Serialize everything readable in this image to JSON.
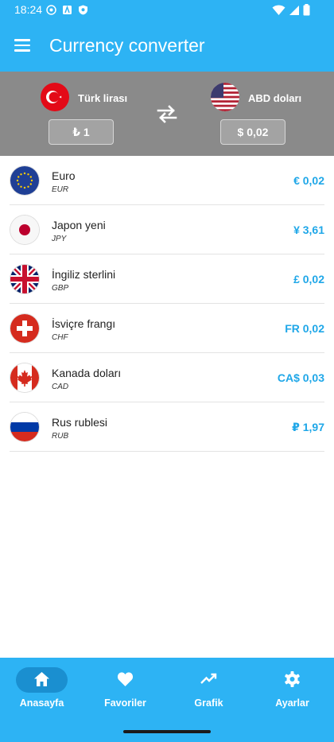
{
  "status_bar": {
    "time": "18:24"
  },
  "app_bar": {
    "title": "Currency converter"
  },
  "converter": {
    "from": {
      "name": "Türk lirası",
      "value": "₺ 1",
      "flag": "turkey-flag"
    },
    "to": {
      "name": "ABD doları",
      "value": "$ 0,02",
      "flag": "usa-flag"
    }
  },
  "currencies": [
    {
      "name": "Euro",
      "code": "EUR",
      "amount": "€ 0,02",
      "flag": "eu-flag"
    },
    {
      "name": "Japon yeni",
      "code": "JPY",
      "amount": "¥ 3,61",
      "flag": "japan-flag"
    },
    {
      "name": "İngiliz sterlini",
      "code": "GBP",
      "amount": "£ 0,02",
      "flag": "uk-flag"
    },
    {
      "name": "İsviçre frangı",
      "code": "CHF",
      "amount": "FR 0,02",
      "flag": "switzerland-flag"
    },
    {
      "name": "Kanada doları",
      "code": "CAD",
      "amount": "CA$ 0,03",
      "flag": "canada-flag"
    },
    {
      "name": "Rus rublesi",
      "code": "RUB",
      "amount": "₽ 1,97",
      "flag": "russia-flag"
    }
  ],
  "bottom_nav": [
    {
      "label": "Anasayfa",
      "icon": "home-icon",
      "active": true
    },
    {
      "label": "Favoriler",
      "icon": "heart-icon",
      "active": false
    },
    {
      "label": "Grafik",
      "icon": "trending-up-icon",
      "active": false
    },
    {
      "label": "Ayarlar",
      "icon": "gear-icon",
      "active": false
    }
  ],
  "colors": {
    "primary": "#2db3f4",
    "accent_amount": "#1fa7e8",
    "converter_bg": "#8a8a8a"
  }
}
